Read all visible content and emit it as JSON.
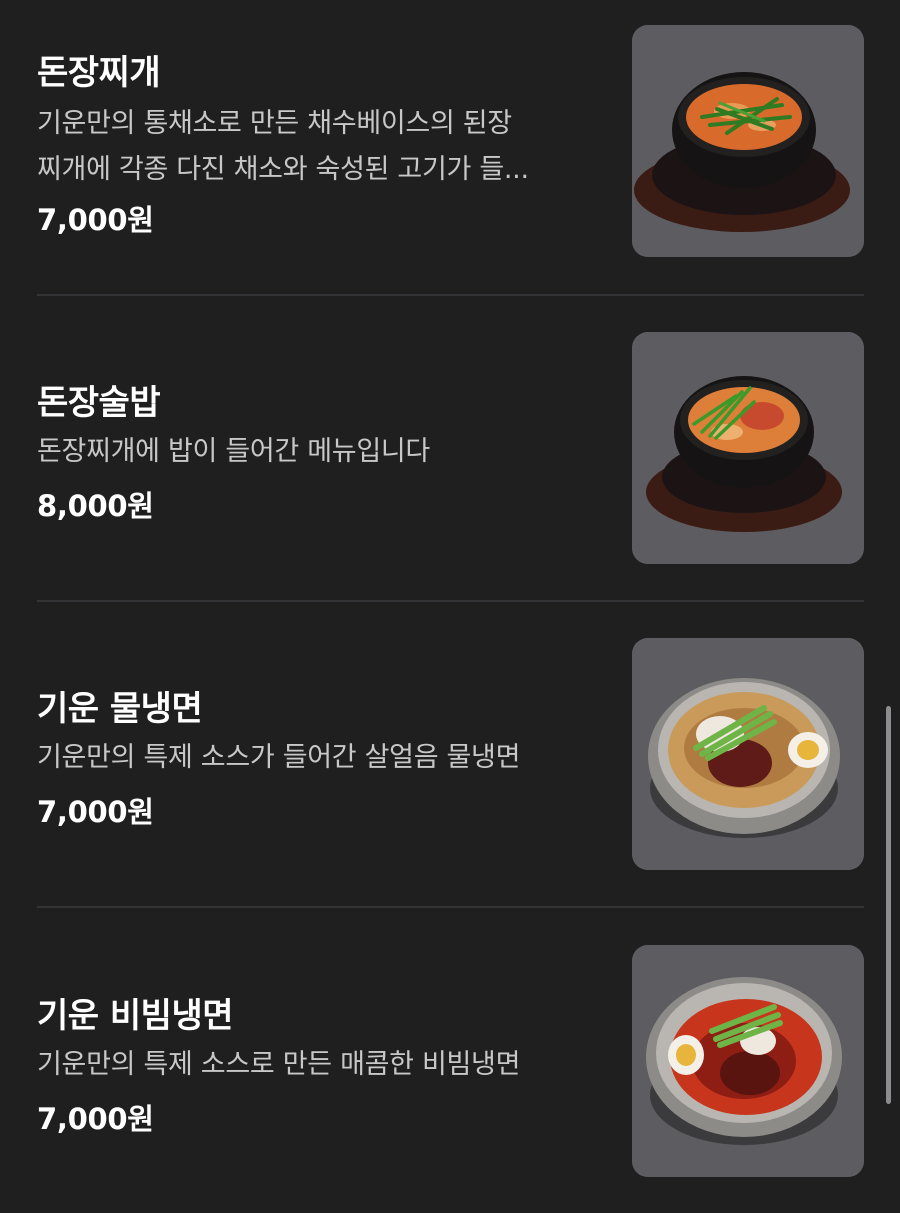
{
  "menu": {
    "items": [
      {
        "name": "돈장찌개",
        "description": "기운만의 통채소로 만든 채수베이스의 된장\n찌개에 각종 다진 채소와 숙성된 고기가 들...",
        "price": "7,000원",
        "image": "doenjang-jjigae-photo"
      },
      {
        "name": "돈장술밥",
        "description": "돈장찌개에 밥이 들어간 메뉴입니다",
        "price": "8,000원",
        "image": "doenjang-sulbap-photo"
      },
      {
        "name": "기운 물냉면",
        "description": "기운만의 특제 소스가 들어간 살얼음 물냉면",
        "price": "7,000원",
        "image": "mul-naengmyeon-photo"
      },
      {
        "name": "기운 비빔냉면",
        "description": "기운만의 특제 소스로 만든 매콤한 비빔냉면",
        "price": "7,000원",
        "image": "bibim-naengmyeon-photo"
      }
    ]
  },
  "colors": {
    "background": "#1f1f20",
    "divider": "#343436",
    "text_primary": "#ffffff",
    "text_secondary": "#c8c8c8",
    "scrollbar": "#8c8c8e"
  }
}
